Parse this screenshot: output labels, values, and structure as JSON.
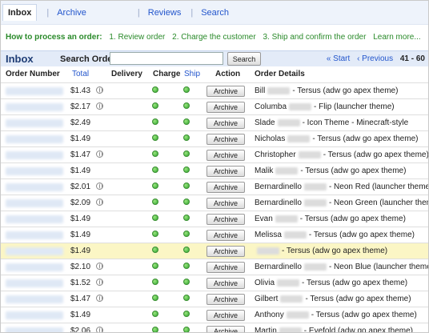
{
  "nav": {
    "items": [
      {
        "label": "Inbox",
        "active": true
      },
      {
        "label": "Archive",
        "active": false
      },
      {
        "label": "Reviews",
        "active": false
      },
      {
        "label": "Search",
        "active": false
      }
    ]
  },
  "process": {
    "heading": "How to process an order:",
    "steps": [
      "1. Review order",
      "2. Charge the customer",
      "3. Ship and confirm the order"
    ],
    "learn_more": "Learn more..."
  },
  "inbox_bar": {
    "title": "Inbox",
    "search_label": "Search Orders:",
    "search_value": "",
    "search_button": "Search",
    "pager_start": "« Start",
    "pager_previous": "‹ Previous",
    "pager_range": "41 - 60"
  },
  "table": {
    "headers": {
      "order_number": "Order Number",
      "total": "Total",
      "delivery": "Delivery",
      "charge": "Charge",
      "ship": "Ship",
      "action": "Action",
      "order_details": "Order Details"
    },
    "archive_label": "Archive",
    "rows": [
      {
        "total": "$1.43",
        "delivery": true,
        "name": "Bill",
        "desc": "- Tersus (adw go apex theme)",
        "highlight": false
      },
      {
        "total": "$2.17",
        "delivery": true,
        "name": "Columba",
        "desc": "- Flip (launcher theme)",
        "highlight": false
      },
      {
        "total": "$2.49",
        "delivery": false,
        "name": "Slade",
        "desc": "- Icon Theme - Minecraft-style",
        "highlight": false
      },
      {
        "total": "$1.49",
        "delivery": false,
        "name": "Nicholas",
        "desc": "- Tersus (adw go apex theme)",
        "highlight": false
      },
      {
        "total": "$1.47",
        "delivery": true,
        "name": "Christopher",
        "desc": "- Tersus (adw go apex theme)",
        "highlight": false
      },
      {
        "total": "$1.49",
        "delivery": false,
        "name": "Malik",
        "desc": "- Tersus (adw go apex theme)",
        "highlight": false
      },
      {
        "total": "$2.01",
        "delivery": true,
        "name": "Bernardinello",
        "desc": "- Neon Red (launcher theme)",
        "highlight": false
      },
      {
        "total": "$2.09",
        "delivery": true,
        "name": "Bernardinello",
        "desc": "- Neon Green (launcher theme)",
        "highlight": false
      },
      {
        "total": "$1.49",
        "delivery": false,
        "name": "Evan",
        "desc": "- Tersus (adw go apex theme)",
        "highlight": false
      },
      {
        "total": "$1.49",
        "delivery": false,
        "name": "Melissa",
        "desc": "- Tersus (adw go apex theme)",
        "highlight": false
      },
      {
        "total": "$1.49",
        "delivery": false,
        "name": "",
        "desc": "- Tersus (adw go apex theme)",
        "highlight": true
      },
      {
        "total": "$2.10",
        "delivery": true,
        "name": "Bernardinello",
        "desc": "- Neon Blue (launcher theme)",
        "highlight": false
      },
      {
        "total": "$1.52",
        "delivery": true,
        "name": "Olivia",
        "desc": "- Tersus (adw go apex theme)",
        "highlight": false
      },
      {
        "total": "$1.47",
        "delivery": true,
        "name": "Gilbert",
        "desc": "- Tersus (adw go apex theme)",
        "highlight": false
      },
      {
        "total": "$1.49",
        "delivery": false,
        "name": "Anthony",
        "desc": "- Tersus (adw go apex theme)",
        "highlight": false
      },
      {
        "total": "$2.06",
        "delivery": true,
        "name": "Martin",
        "desc": "- Eyefold (adw go apex theme)",
        "highlight": false
      }
    ]
  },
  "colors": {
    "link": "#2255cc",
    "process_green": "#2a8a2a",
    "bar_blue": "#e3ebf8",
    "highlight_row": "#fbf6c5",
    "status_green": "#2ea52e"
  }
}
